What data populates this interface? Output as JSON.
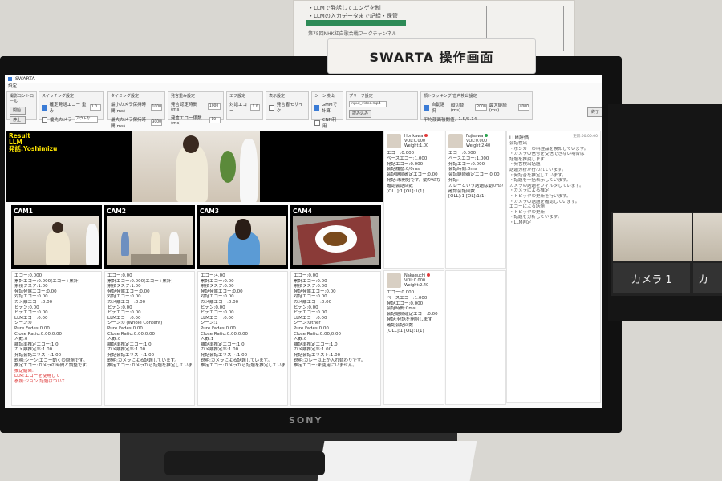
{
  "sign": {
    "title": "SWARTA 操作画面"
  },
  "poster": {
    "line1": "・LLMで発話してエンゲを制",
    "line2": "・LLMの入カデータまで記録・保管",
    "line3": "第75回NHK紅白歌合戦ワークチャンネル"
  },
  "monitor": {
    "brand": "SONY"
  },
  "app": {
    "title": "SWARTA",
    "menu": "設定",
    "exit_button": "終了"
  },
  "controls": {
    "group1": {
      "label": "撮影コントロール",
      "btn1": "開始",
      "btn2": "停止"
    },
    "group2": {
      "label": "スイッチング設定",
      "check1": "確定発話エコー 重み",
      "value1": "1.0",
      "check2": "優先カメラ",
      "select": "アウトな"
    },
    "group3": {
      "label": "タイミング設定",
      "line1": "最小カメラ保持時間(ms)",
      "value1": "1000",
      "line2": "最大カメラ保持時間(ms)",
      "value2": "3000"
    },
    "group4": {
      "label": "発言重み設定",
      "line1": "発言認定時間(ms)",
      "value1": "1000",
      "line2": "発言エコー係数(ms)",
      "value2": "10"
    },
    "group5": {
      "label": "エフ設定",
      "line1": "対話エコー",
      "value1": "1.0"
    },
    "group6": {
      "label": "表示設定",
      "check1": "発言者モザイク"
    },
    "group7": {
      "label": "シーン検出",
      "check1": "GMMで計算",
      "check2": "CNN利用"
    },
    "group8": {
      "label": "プリーフ設定",
      "select": "input_video.mp4",
      "button": "読み込み"
    },
    "group9": {
      "label": "顔トラッキング/音声検出設定",
      "check1": "自動選択",
      "field1": "顔切替(ms)",
      "value1": "2000",
      "field2": "最大継続(ms)",
      "value2": "4000",
      "line2": "平均顔面積閾値:",
      "value3": "1.5/5.14"
    }
  },
  "result": {
    "label": "Result",
    "line2": "LLM",
    "line3": "発話:Yoshimizu"
  },
  "cams": [
    {
      "label": "CAM1",
      "lines": [
        "エコー:0.000",
        "累計エコー:0.000(エコー+累計)",
        "累積タスク:1.00",
        "発話発露エコー:0.00",
        "対話エコー:0.00",
        "カメ離エコー:0.00",
        "ヒデン:0.00",
        "ヒデエコー:0.00",
        "LLMエコー:0.00",
        "シーン:0",
        "Pure Fades:0.00",
        "Close Ratio:0.00,0.00",
        "人数:0",
        "離話率推定エコー:1.0",
        "カメ離推定率:1.00",
        "発話会話エリスト:1.00",
        "説明:シーン:エコー動くの問題です。",
        "推定エコー:カメラの時間と調整です。"
      ],
      "red": [
        "推定結果:",
        "LLM:エコーを使用して",
        "参照:ジョン:話題はついて"
      ]
    },
    {
      "label": "CAM2",
      "lines": [
        "エコー:0.00",
        "累計エコー:0.000(エコー+累計)",
        "累積タスク:1.00",
        "発話発露エコー:0.00",
        "対話エコー:0.00",
        "カメ離エコー:0.00",
        "ヒデン:0.00",
        "ヒデエコー:0.00",
        "LLMエコー:0.00",
        "シーン:0 (Whole Content)",
        "Pure Fades:0.00",
        "Close Ratio:0.00,0.00",
        "人数:0",
        "離話率推定エコー:1.0",
        "カメ離推定率:1.00",
        "発話会話エリスト:1.00",
        "説明:カメラによる話題しています。",
        "推定エコー:カメラから話題を推定しています。"
      ],
      "red": []
    },
    {
      "label": "CAM3",
      "lines": [
        "エコー:4.00",
        "累計エコー:0.00",
        "累積タスク:0.00",
        "発話発露エコー:0.00",
        "対話エコー:0.00",
        "カメ離エコー:0.00",
        "ヒデン:0.00",
        "ヒデエコー:0.00",
        "LLMエコー:0.00",
        "シーン:1",
        "Pure Fades:0.00",
        "Close Ratio:0.00,0.00",
        "人数:1",
        "離話率推定エコー:1.0",
        "カメ離推定率:1.00",
        "発話会話エリスト:1.00",
        "説明:カメラによる話題しています。",
        "推定エコー:カメラから話題を推定しています。"
      ],
      "red": []
    },
    {
      "label": "CAM4",
      "lines": [
        "エコー:0.00",
        "累計エコー:0.00",
        "累積タスク:0.00",
        "発話発露エコー:0.00",
        "対話エコー:0.00",
        "カメ離エコー:0.00",
        "ヒデン:0.00",
        "ヒデエコー:0.00",
        "LLMエコー:0.00",
        "シーン:Other",
        "Pure Fades:0.00",
        "Close Ratio:0.00,0.00",
        "人数:0",
        "離話率推定エコー:1.0",
        "カメ離推定率:1.00",
        "発話会話エリスト:1.00",
        "説明:カレー以上が入れ替わりです。",
        "推定エコー:未使用にいません。"
      ],
      "red": []
    }
  ],
  "avatars": [
    {
      "name": "Horikawa",
      "vol": "VOL:0.000",
      "weight": "Weight:1.00",
      "status_color": "#e23b3b",
      "lines": [
        "エコー:0.000",
        "ベースエコー:1.000",
        "発話エコー:0.000",
        "会話履歴:0/0ms",
        "会話継続確定エコー:0.00",
        "発話:未開始です。動かせない",
        "確認会話回数",
        "[OLL]:1 [OL]:1(1)"
      ]
    },
    {
      "name": "Fujisawa",
      "vol": "VOL:0.000",
      "weight": "Weight:2.40",
      "status_color": "#2aa44f",
      "lines": [
        "エコー:0.000",
        "ベースエコー:1.000",
        "発話エコー:0.000",
        "会話時間:0ms",
        "会話継続確定エコー:0.00",
        "発話:",
        "カレーという話題は動かせない",
        "確認会話回数",
        "[OLL]:1 [OL]:1(1)"
      ]
    },
    {
      "name": "Nakaguchi",
      "vol": "VOL:0.000",
      "weight": "Weight:2.40",
      "status_color": "#e23b3b",
      "lines": [
        "エコー:0.000",
        "ベースエコー:1.000",
        "発話エコー:0.000",
        "会話時間:0ms",
        "会話継続確定エコー:0.00",
        "発話:発話を開始します",
        "確認会話回数",
        "[OLL]:1 [OL]:1(1)"
      ]
    }
  ],
  "llm": {
    "title": "LLM評価",
    "subtitle": "更新:00:00:00",
    "lines": [
      "会話検出",
      "・ポンカーの料理品を検知しています。",
      "・カメラの信号を受信できない場合は",
      "話題を推奨します",
      "・発言検出話題",
      "話題分析が行われています。",
      "・発話音を推定しています。",
      "・話題を一括表示しています。",
      "カメラの話題をフィルタしています。",
      "・カメラによる推定",
      "・トピックの更新を行います。",
      "・カメラの話題を確認しています。",
      "エコーによる話題",
      "・トピックの更新",
      "・話題を分析しています。",
      "・LLM判定"
    ]
  },
  "monitor2": {
    "label1": "カメラ 1",
    "label2": "カ"
  }
}
